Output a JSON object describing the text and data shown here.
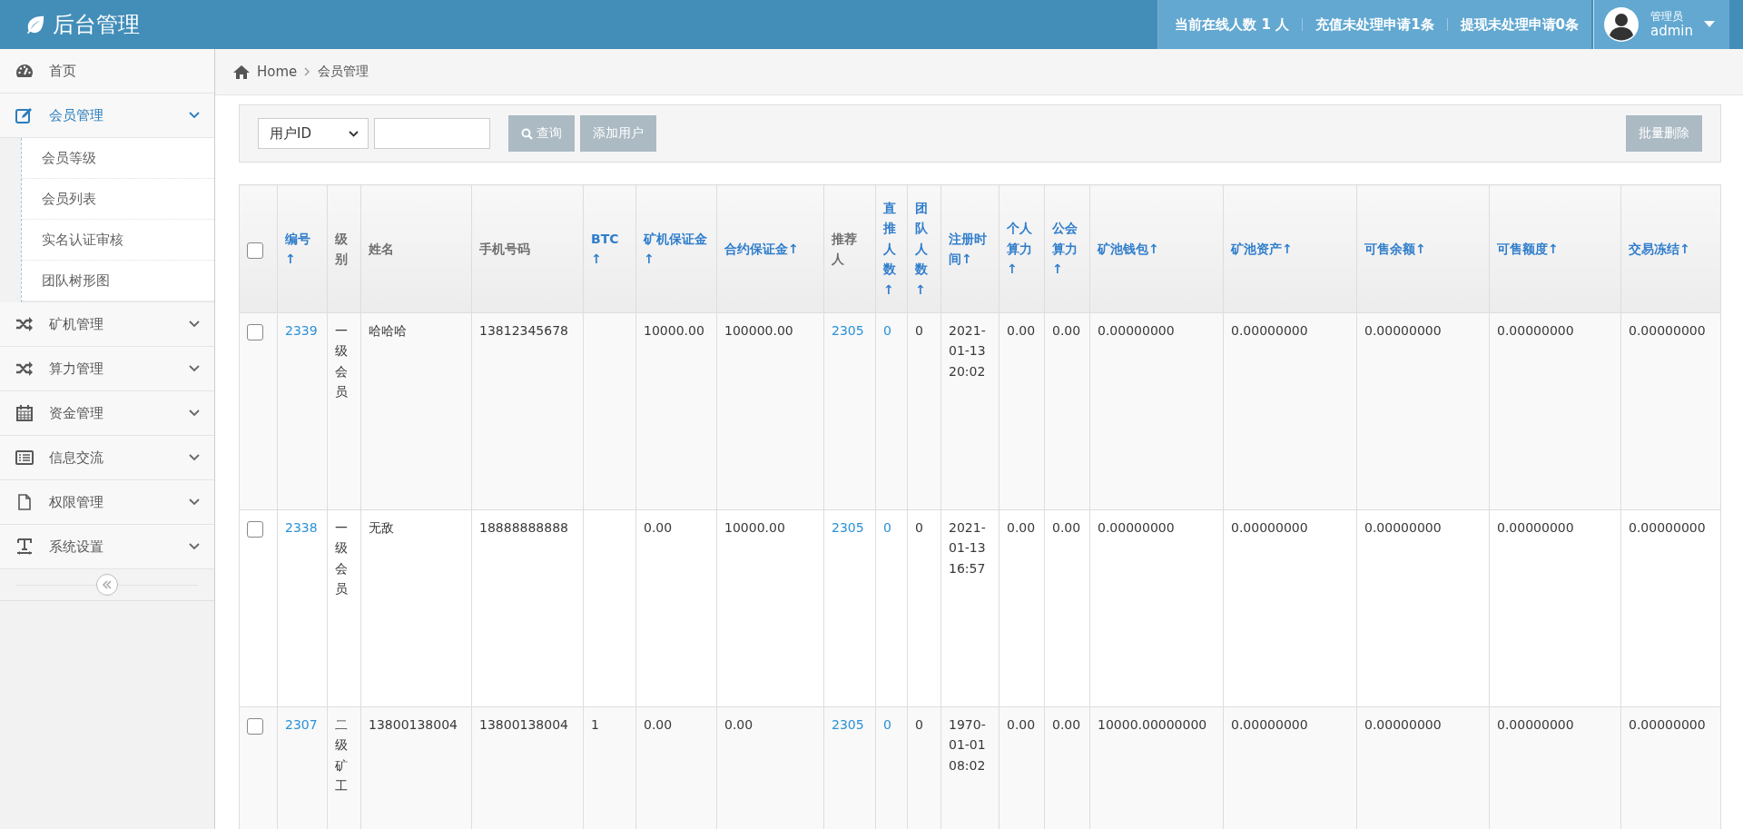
{
  "header": {
    "title": "后台管理",
    "stats": [
      "当前在线人数 1 人",
      "充值未处理申请1条",
      "提现未处理申请0条"
    ],
    "user": {
      "role": "管理员",
      "name": "admin"
    }
  },
  "sidebar": {
    "items": [
      {
        "label": "首页",
        "selected": false
      },
      {
        "label": "会员管理",
        "expanded": true,
        "selected": true,
        "children": [
          {
            "label": "会员等级"
          },
          {
            "label": "会员列表"
          },
          {
            "label": "实名认证审核"
          },
          {
            "label": "团队树形图"
          }
        ]
      },
      {
        "label": "矿机管理",
        "expanded": false,
        "selected": false
      },
      {
        "label": "算力管理",
        "expanded": false,
        "selected": false
      },
      {
        "label": "资金管理",
        "expanded": false,
        "selected": false
      },
      {
        "label": "信息交流",
        "expanded": false,
        "selected": false
      },
      {
        "label": "权限管理",
        "expanded": false,
        "selected": false
      },
      {
        "label": "系统设置",
        "expanded": false,
        "selected": false
      }
    ]
  },
  "breadcrumb": [
    "Home",
    "会员管理"
  ],
  "toolbar": {
    "select": "用户ID",
    "search_button": "查询",
    "add_button": "添加用户",
    "delete_button": "批量删除"
  },
  "table": {
    "header_checked": false,
    "columns": [
      {
        "label": "编号↑",
        "sortable": true,
        "link": true
      },
      {
        "label": "级别",
        "sortable": false,
        "link": false
      },
      {
        "label": "姓名",
        "sortable": false,
        "link": false
      },
      {
        "label": "手机号码",
        "sortable": false,
        "link": false
      },
      {
        "label": "BTC↑",
        "sortable": true,
        "link": false
      },
      {
        "label": "矿机保证金↑",
        "sortable": true,
        "link": false
      },
      {
        "label": "合约保证金↑",
        "sortable": true,
        "link": false
      },
      {
        "label": "推荐人",
        "sortable": false,
        "link": true
      },
      {
        "label": "直推人数↑",
        "sortable": true,
        "link": true
      },
      {
        "label": "团队人数↑",
        "sortable": true,
        "link": false
      },
      {
        "label": "注册时间↑",
        "sortable": true,
        "link": false
      },
      {
        "label": "个人算力↑",
        "sortable": true,
        "link": false
      },
      {
        "label": "公会算力↑",
        "sortable": true,
        "link": false
      },
      {
        "label": "矿池钱包↑",
        "sortable": true,
        "link": false
      },
      {
        "label": "矿池资产↑",
        "sortable": true,
        "link": false
      },
      {
        "label": "可售余额↑",
        "sortable": true,
        "link": false
      },
      {
        "label": "可售额度↑",
        "sortable": true,
        "link": false
      },
      {
        "label": "交易冻结↑",
        "sortable": true,
        "link": false
      }
    ],
    "rows": [
      {
        "checked": false,
        "cells": [
          "2339",
          "一级会员",
          "哈哈哈",
          "13812345678",
          "",
          "10000.00",
          "100000.00",
          "2305",
          "0",
          "0",
          "2021-01-13 20:02",
          "0.00",
          "0.00",
          "0.00000000",
          "0.00000000",
          "0.00000000",
          "0.00000000",
          "0.00000000"
        ]
      },
      {
        "checked": false,
        "cells": [
          "2338",
          "一级会员",
          "无敌",
          "18888888888",
          "",
          "0.00",
          "10000.00",
          "2305",
          "0",
          "0",
          "2021-01-13 16:57",
          "0.00",
          "0.00",
          "0.00000000",
          "0.00000000",
          "0.00000000",
          "0.00000000",
          "0.00000000"
        ]
      },
      {
        "checked": false,
        "cells": [
          "2307",
          "二级矿工",
          "13800138004",
          "13800138004",
          "1",
          "0.00",
          "0.00",
          "2305",
          "0",
          "0",
          "1970-01-01 08:02",
          "0.00",
          "0.00",
          "10000.00000000",
          "0.00000000",
          "0.00000000",
          "0.00000000",
          "0.00000000"
        ]
      }
    ]
  }
}
